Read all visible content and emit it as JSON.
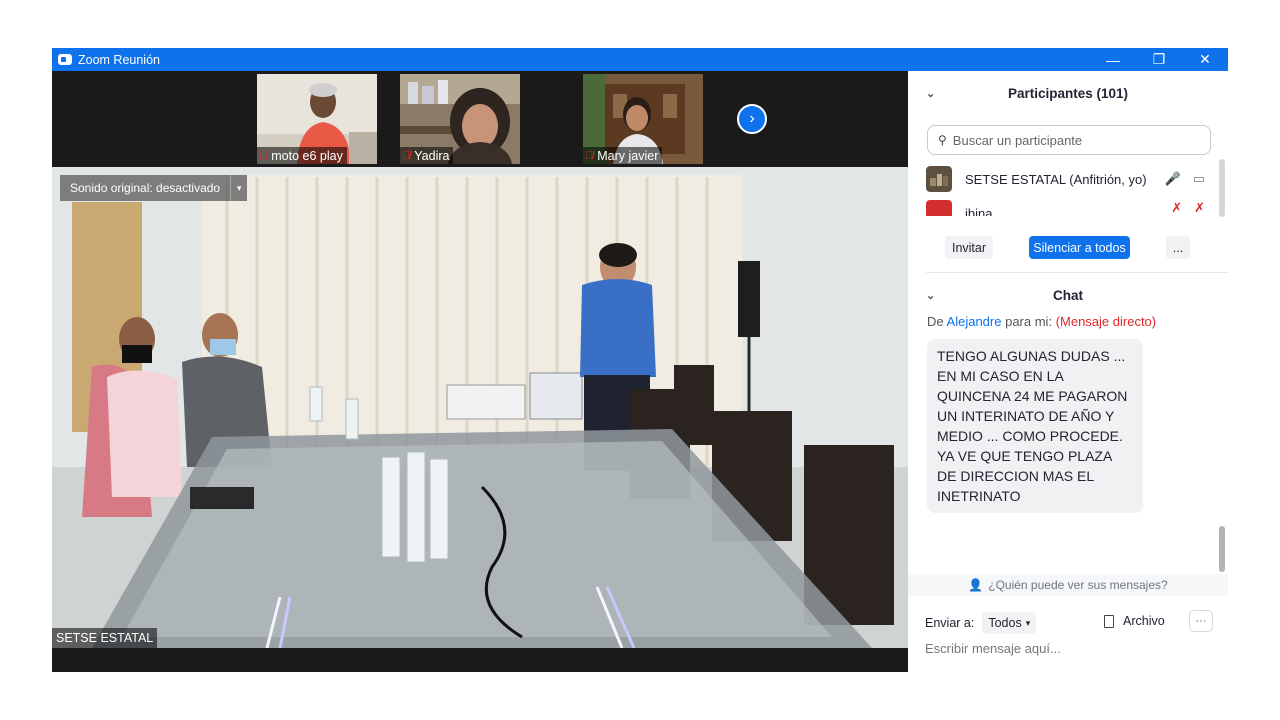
{
  "window": {
    "title": "Zoom Reunión",
    "controls": {
      "minimize": "—",
      "restore": "❐",
      "close": "✕"
    }
  },
  "strip": {
    "thumbnails": [
      {
        "name": "moto e6 play",
        "muted": true
      },
      {
        "name": "Yadira",
        "muted": true
      },
      {
        "name": "Mary javier",
        "muted": true
      }
    ],
    "next_icon": "›"
  },
  "main_video": {
    "sound_label": "Sonido original: desactivado",
    "dropdown_icon": "▾",
    "speaker_name": "SETSE ESTATAL"
  },
  "participants": {
    "header": "Participantes (101)",
    "search_placeholder": "Buscar un participante",
    "rows": [
      {
        "name": "SETSE ESTATAL (Anfitrión, yo)",
        "avatar_color": "#5d5040"
      },
      {
        "name": "ibina",
        "avatar_color": "#d32f2f"
      }
    ],
    "buttons": {
      "invite": "Invitar",
      "mute_all": "Silenciar a todos",
      "more": "..."
    }
  },
  "chat": {
    "header": "Chat",
    "from_prefix": "De",
    "from_user": "Alejandre",
    "to_me": "para mi:",
    "direct": "(Mensaje directo)",
    "message": "TENGO ALGUNAS DUDAS ... EN MI CASO EN LA QUINCENA 24 ME PAGARON UN INTERINATO DE AÑO Y MEDIO ... COMO PROCEDE. YA VE QUE TENGO PLAZA DE DIRECCION MAS EL INETRINATO",
    "who_can_see": "¿Quién puede ver sus mensajes?",
    "send_to_label": "Enviar a:",
    "send_to_value": "Todos",
    "file_label": "Archivo",
    "more": "···",
    "input_placeholder": "Escribir mensaje aquí..."
  },
  "colors": {
    "accent": "#0e72ed",
    "muted_red": "#e02828"
  }
}
